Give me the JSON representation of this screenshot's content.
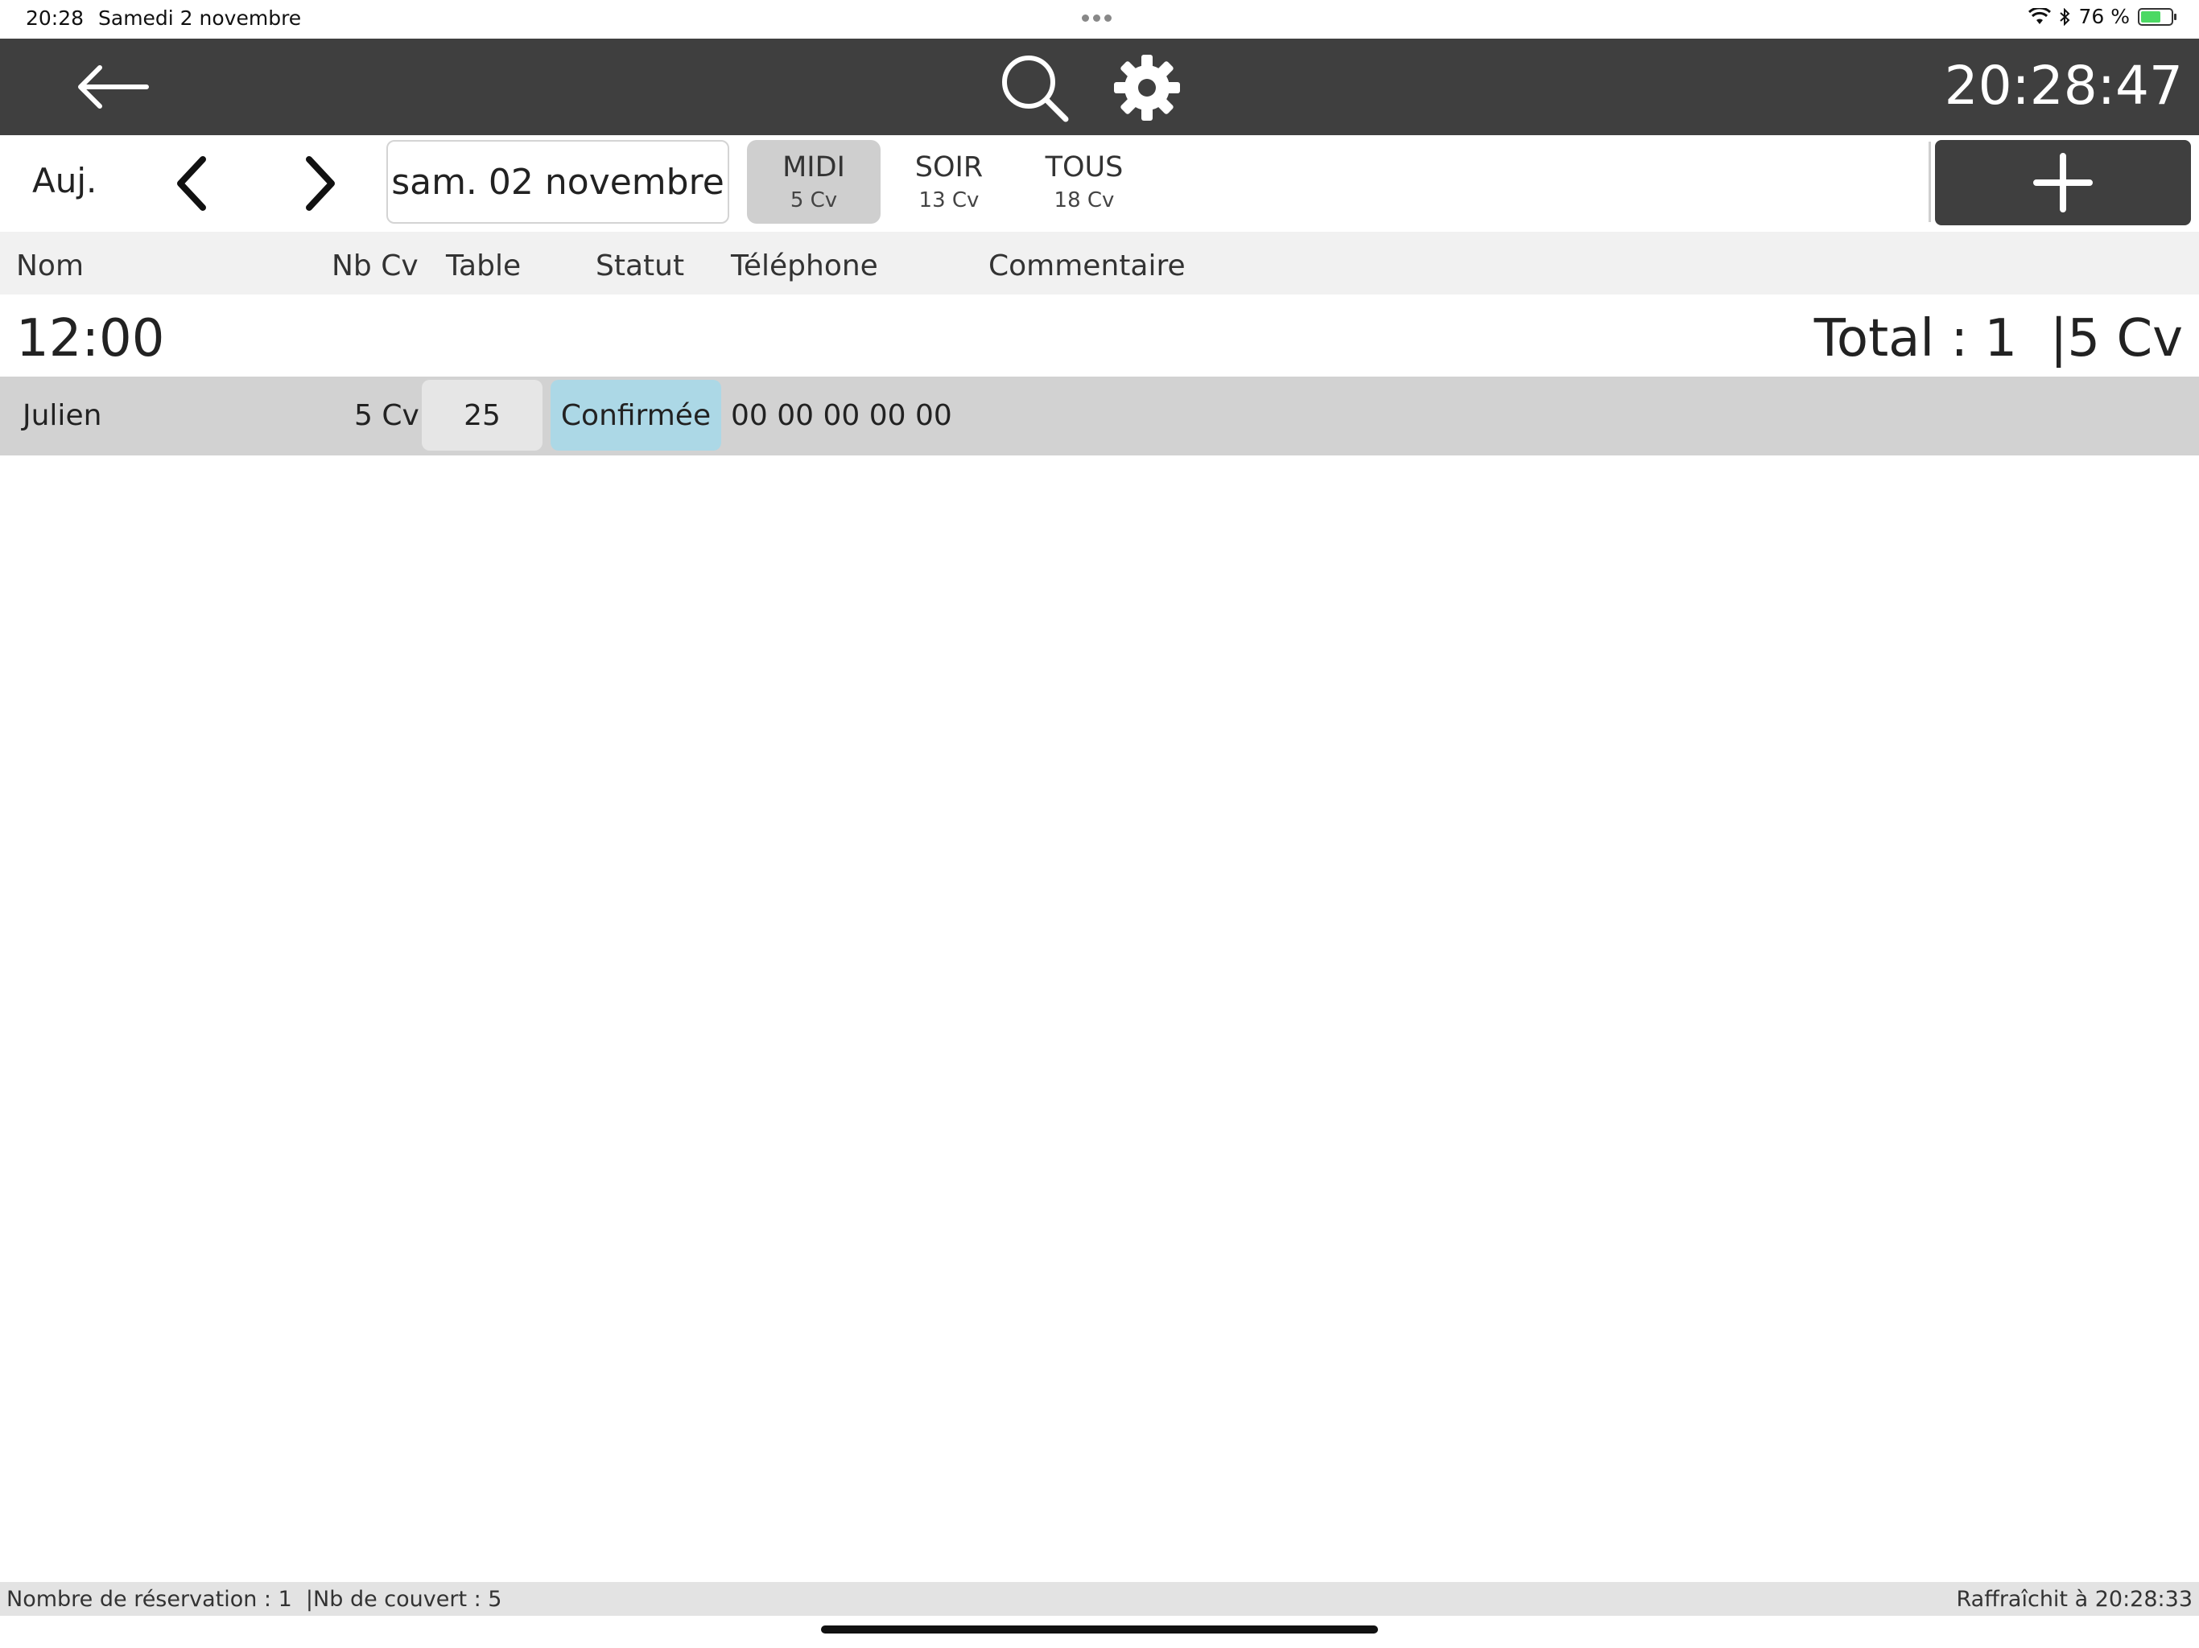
{
  "status_bar": {
    "time": "20:28",
    "date": "Samedi 2 novembre",
    "battery_text": "76 %",
    "battery_level": 0.76,
    "icons": [
      "wifi-icon",
      "bluetooth-icon",
      "battery-icon"
    ]
  },
  "toolbar": {
    "back_icon": "back-arrow-icon",
    "search_icon": "search-icon",
    "settings_icon": "gear-icon",
    "clock": "20:28:47",
    "background": "#3f3f3f"
  },
  "date_bar": {
    "today_label": "Auj.",
    "prev_icon": "chevron-left-icon",
    "next_icon": "chevron-right-icon",
    "current_date": "sam. 02 novembre",
    "add_icon": "plus-icon"
  },
  "services": [
    {
      "label": "MIDI",
      "count": "5 Cv",
      "active": true
    },
    {
      "label": "SOIR",
      "count": "13 Cv",
      "active": false
    },
    {
      "label": "TOUS",
      "count": "18 Cv",
      "active": false
    }
  ],
  "columns": {
    "name": "Nom",
    "nb_cv": "Nb Cv",
    "table": "Table",
    "status": "Statut",
    "phone": "Téléphone",
    "comment": "Commentaire"
  },
  "groups": [
    {
      "time": "12:00",
      "total": "Total : 1  |5 Cv",
      "reservations": [
        {
          "name": "Julien",
          "nb_cv": "5 Cv",
          "table": "25",
          "status": "Confirmée",
          "status_color": "#acd8e6",
          "phone": "00 00 00 00 00",
          "comment": ""
        }
      ]
    }
  ],
  "footer": {
    "summary": "Nombre de réservation : 1  |Nb de couvert : 5",
    "refresh": "Raffraîchit à 20:28:33"
  }
}
